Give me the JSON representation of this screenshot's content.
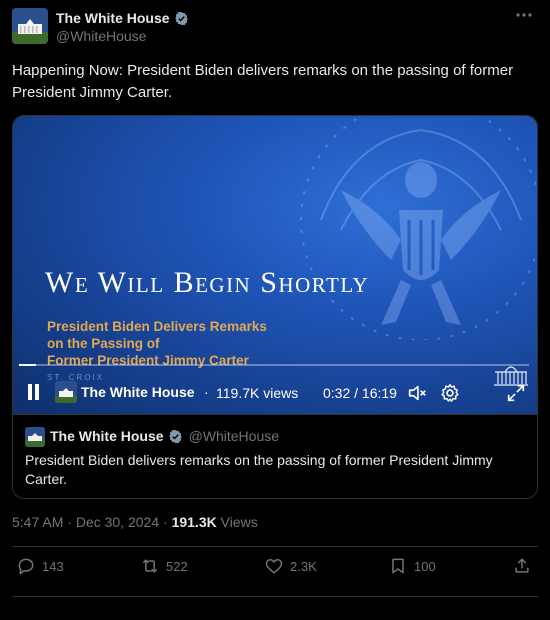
{
  "author": {
    "display_name": "The White House",
    "handle": "@WhiteHouse",
    "verified": true
  },
  "more_icon": "more-horizontal-icon",
  "tweet": {
    "text": "Happening Now: President Biden delivers remarks on the passing of former President Jimmy Carter."
  },
  "video": {
    "headline": "We Will Begin Shortly",
    "subtitle_lines": [
      "President Biden Delivers Remarks",
      "on the Passing of",
      "Former President Jimmy Carter"
    ],
    "location_text": "ST. CROIX",
    "progress_fraction": 0.034,
    "channel_name": "The White House",
    "separator": "·",
    "views": "119.7K views",
    "time": "0:32 / 16:19",
    "icons": [
      "pause-icon",
      "mute-icon",
      "settings-icon",
      "fullscreen-icon"
    ]
  },
  "quote": {
    "display_name": "The White House",
    "handle": "@WhiteHouse",
    "text": "President Biden delivers remarks on the passing of former President Jimmy Carter."
  },
  "meta": {
    "time": "5:47 AM",
    "dot": " · ",
    "date": "Dec 30, 2024",
    "dot2": " · ",
    "views_count": "191.3K",
    "views_label": "Views"
  },
  "actions": {
    "replies": "143",
    "reposts": "522",
    "likes": "2.3K",
    "bookmarks": "100"
  },
  "colors": {
    "background": "#000000",
    "text": "#e7e9ea",
    "muted": "#71767b",
    "border": "#2f3336",
    "verified": "#829aab",
    "video_blue": "#1f55b8",
    "subtitle_gold": "#e1a853"
  }
}
